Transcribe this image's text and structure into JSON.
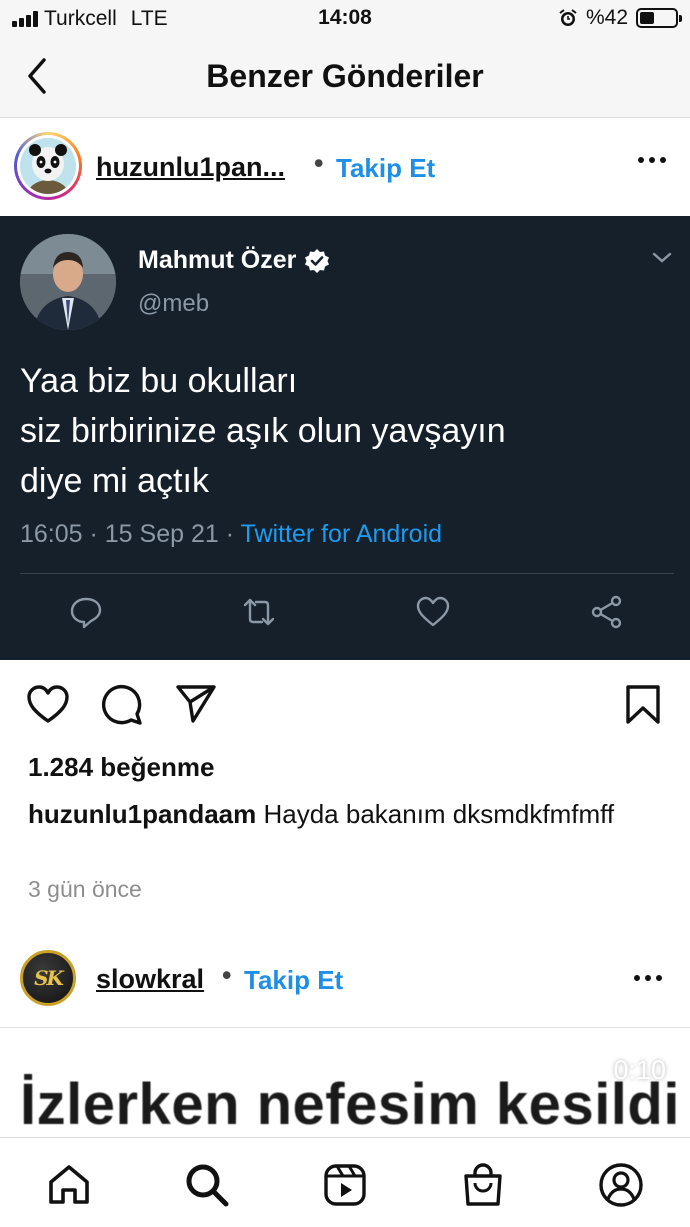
{
  "status_bar": {
    "carrier": "Turkcell",
    "network": "LTE",
    "time": "14:08",
    "battery_text": "%42",
    "battery_level": 0.42
  },
  "header": {
    "title": "Benzer Gönderiler"
  },
  "post": {
    "username_display": "huzunlu1pan...",
    "dot": "•",
    "follow_label": "Takip Et",
    "likes": "1.284 beğenme",
    "caption_username": "huzunlu1pandaam",
    "caption_text": "Hayda bakanım dksmdkfmfmff",
    "time": "3 gün önce"
  },
  "tweet": {
    "name": "Mahmut Özer",
    "handle": "@meb",
    "text": "Yaa biz bu okulları\nsiz birbirinize aşık olun yavşayın\ndiye mi açtık",
    "meta_time": "16:05 · 15 Sep 21 · ",
    "meta_source": "Twitter for Android"
  },
  "post2": {
    "avatar_text": "SK",
    "username": "slowkral",
    "dot": "•",
    "follow_label": "Takip Et",
    "video_text": "İzlerken nefesim kesildi",
    "video_duration": "0:10"
  },
  "colors": {
    "link_blue": "#1f8ee7",
    "tweet_bg": "#15202b",
    "twitter_blue": "#1d9bf0"
  },
  "icons": {
    "back": "chevron-left-icon",
    "more": "more-horizontal-icon",
    "verified": "verified-badge-icon",
    "tweet_actions": [
      "reply-icon",
      "retweet-icon",
      "like-icon",
      "share-icon"
    ],
    "post_actions": [
      "heart-icon",
      "comment-icon",
      "send-icon",
      "bookmark-icon"
    ],
    "tabs": [
      "home-icon",
      "search-icon",
      "reels-icon",
      "shop-icon",
      "profile-icon"
    ]
  }
}
